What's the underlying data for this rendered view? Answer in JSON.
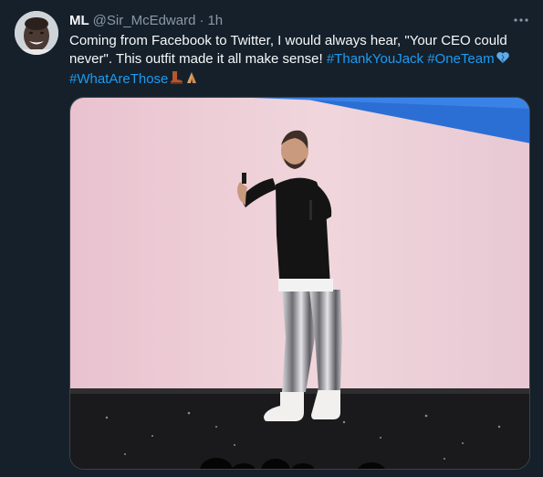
{
  "tweet": {
    "author_name": "ML",
    "handle": "@Sir_McEdward",
    "separator": "·",
    "time": "1h",
    "text_main": "Coming from Facebook to Twitter, I would always hear, \"Your CEO could never\". This outfit made it all make sense! ",
    "hashtags": [
      "#ThankYouJack",
      "#OneTeam",
      "#WhatAreThose"
    ],
    "emojis": [
      "blue-heart",
      "boot",
      "folded-hands"
    ]
  },
  "colors": {
    "background": "#15202b",
    "text": "#f7f9f9",
    "secondary": "#8b98a5",
    "hashtag": "#1d9bf0"
  }
}
